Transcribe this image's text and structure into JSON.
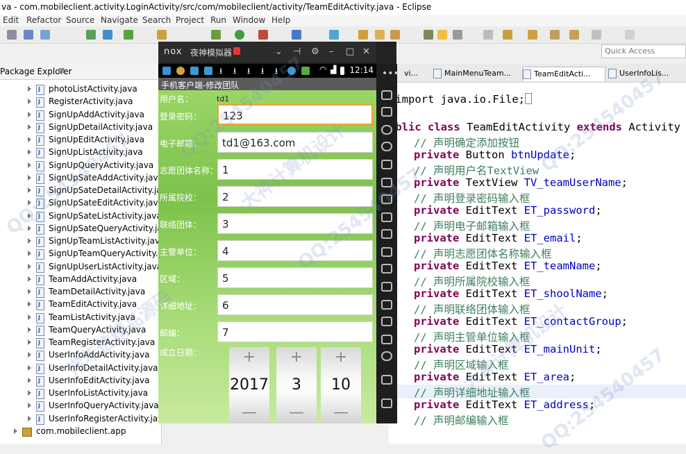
{
  "window": {
    "title": "va - com.mobileclient.activity.LoginActivity/src/com/mobileclient/activity/TeamEditActivity.java - Eclipse"
  },
  "menu": [
    "Edit",
    "Refactor",
    "Source",
    "Navigate",
    "Search",
    "Project",
    "Run",
    "Window",
    "Help"
  ],
  "quick_access": "Quick Access",
  "package_explorer": {
    "title": "Package Explorer",
    "close": "⊠",
    "files": [
      "photoListActivity.java",
      "RegisterActivity.java",
      "SignUpAddActivity.java",
      "SignUpDetailActivity.java",
      "SignUpEditActivity.java",
      "SignUpListActivity.java",
      "SignUpQueryActivity.java",
      "SignUpSateAddActivity.java",
      "SignUpSateDetailActivity.java",
      "SignUpSateEditActivity.java",
      "SignUpSateListActivity.java",
      "SignUpSateQueryActivity.java",
      "SignUpTeamListActivity.java",
      "SignUpTeamQueryActivity.java",
      "SignUpUserListActivity.java",
      "TeamAddActivity.java",
      "TeamDetailActivity.java",
      "TeamEditActivity.java",
      "TeamListActivity.java",
      "TeamQueryActivity.java",
      "TeamRegisterActivity.java",
      "UserInfoAddActivity.java",
      "UserInfoDetailActivity.java",
      "UserInfoEditActivity.java",
      "UserInfoListActivity.java",
      "UserInfoQueryActivity.java",
      "UserInfoRegisterActivity.java"
    ],
    "package": "com.mobileclient.app"
  },
  "editor_tabs": [
    "vi...",
    "MainMenuTeam...",
    "TeamEditActi...",
    "UserInfoLis..."
  ],
  "code": {
    "l0": "import java.io.File;",
    "l1_kw": "ublic class",
    "l1_name": "TeamEditActivity",
    "l1_ext": "extends",
    "l1_sup": "Activity",
    "c_btn": "// 声明确定添加按钮",
    "f_btn_type": "Button",
    "f_btn": "btnUpdate",
    "c_user": "// 声明用户名TextView",
    "f_user_type": "TextView",
    "f_user": "TV_teamUserName",
    "c_pwd": "// 声明登录密码输入框",
    "f_pwd": "ET_password",
    "c_email": "// 声明电子邮箱输入框",
    "f_email": "ET_email",
    "c_team": "// 声明志愿团体名称输入框",
    "f_team": "ET_teamName",
    "c_school": "// 声明所属院校输入框",
    "f_school": "ET_shoolName",
    "c_contact": "// 声明联络团体输入框",
    "f_contact": "ET_contactGroup",
    "c_unit": "// 声明主管单位输入框",
    "f_unit": "ET_mainUnit",
    "c_area": "// 声明区域输入框",
    "f_area": "ET_area",
    "c_addr": "// 声明详细地址输入框",
    "f_addr": "ET_address",
    "c_post": "// 声明邮编输入框",
    "private": "private",
    "edittext": "EditText"
  },
  "emulator": {
    "logo": "nox",
    "name": "夜神模拟器",
    "time": "12:14",
    "app_title": "手机客户端-修改团队",
    "fields": {
      "user_label": "用户名：",
      "user_value": "td1",
      "pwd_label": "登录密码：",
      "pwd_value": "123",
      "email_label": "电子邮箱：",
      "email_value": "td1@163.com",
      "team_label": "志愿团体名称：",
      "team_value": "1",
      "school_label": "所属院校：",
      "school_value": "2",
      "contact_label": "联络团体：",
      "contact_value": "3",
      "unit_label": "主管单位：",
      "unit_value": "4",
      "area_label": "区域：",
      "area_value": "5",
      "addr_label": "详细地址：",
      "addr_value": "6",
      "post_label": "邮编：",
      "post_value": "7",
      "date_label": "成立日期："
    },
    "date": {
      "year": "2017",
      "month": "3",
      "day": "10",
      "plus": "+",
      "minus": "—"
    }
  },
  "watermarks": [
    "QQ:254540457",
    "常年信精品源码",
    "大神计算机设计"
  ]
}
